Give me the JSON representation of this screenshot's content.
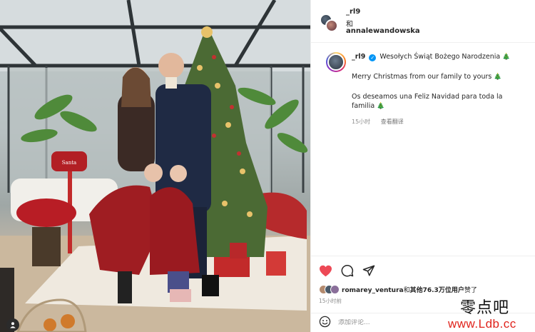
{
  "header": {
    "user1": "_rl9",
    "and": "和",
    "user2": "annalewandowska"
  },
  "caption": {
    "username": "_rl9",
    "verified_glyph": "✓",
    "title": "Wesołych Świąt Bożego Narodzenia",
    "line_en": "Merry Christmas from our family to yours",
    "line_es": "Os deseamos una Feliz Navidad para toda la familia",
    "tree_emoji": "🎄",
    "time": "15小时",
    "translate": "查看翻译"
  },
  "actions": {
    "like_icon": "heart-filled-icon",
    "comment_icon": "comment-icon",
    "share_icon": "share-icon",
    "like_color": "#ed4956"
  },
  "likes": {
    "user": "romarey_ventura",
    "suffix_1": "和",
    "others": "其他76.3万位用户",
    "suffix_2": "赞了"
  },
  "post_time": "15小时前",
  "comment": {
    "placeholder": "添加评论..."
  },
  "watermark": {
    "cn": "零点吧",
    "url": "www.Ldb.cc"
  }
}
